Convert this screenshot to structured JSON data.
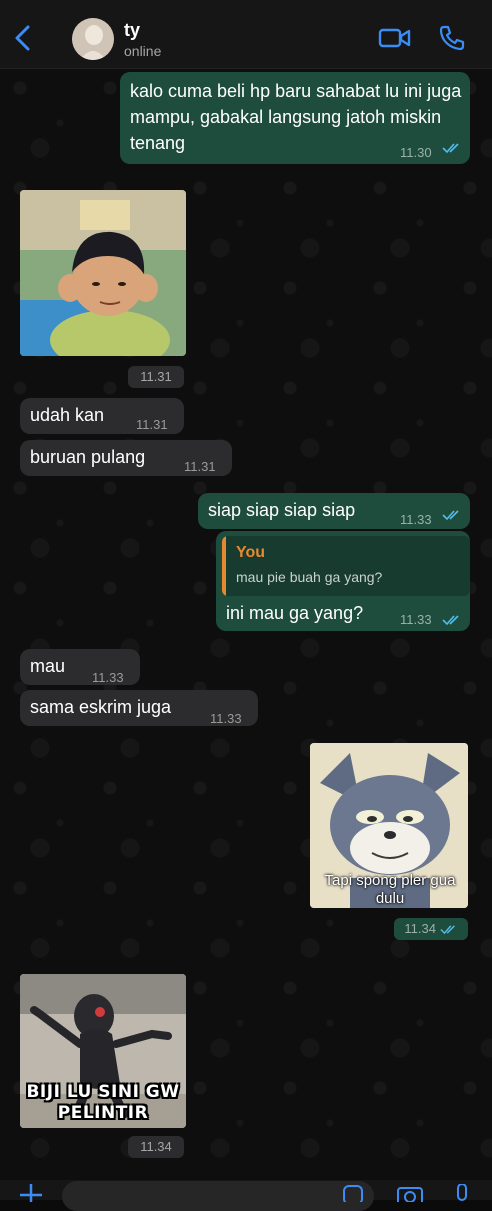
{
  "header": {
    "contact_name": "ty",
    "status": "online"
  },
  "messages": {
    "m1": {
      "text": "kalo cuma beli hp baru sahabat lu ini juga mampu, gabakal langsung jatoh miskin tenang",
      "time": "11.30"
    },
    "m2": {
      "time": "11.31"
    },
    "m3": {
      "text": "udah kan",
      "time": "11.31"
    },
    "m4": {
      "text": "buruan pulang",
      "time": "11.31"
    },
    "m5": {
      "text": "siap siap siap siap",
      "time": "11.33"
    },
    "m6": {
      "reply_author": "You",
      "reply_text": "mau pie buah ga yang?",
      "text": "ini mau ga yang?",
      "time": "11.33"
    },
    "m7": {
      "text": "mau",
      "time": "11.33"
    },
    "m8": {
      "text": "sama eskrim juga",
      "time": "11.33"
    },
    "m9": {
      "caption": "Tapi spong pler gua dulu",
      "time": "11.34"
    },
    "m10": {
      "meme_text": "BIJI LU SINI GW PELINTIR",
      "time": "11.34"
    }
  },
  "colors": {
    "outgoing_bubble": "#1f4d3d",
    "incoming_bubble": "#2c2c2e",
    "accent_blue": "#3b8df5",
    "read_ticks": "#53bdeb",
    "reply_author": "#e58a2e"
  },
  "icons": [
    "back-chevron-icon",
    "video-call-icon",
    "phone-icon",
    "plus-icon",
    "sticker-icon",
    "camera-icon",
    "microphone-icon"
  ]
}
